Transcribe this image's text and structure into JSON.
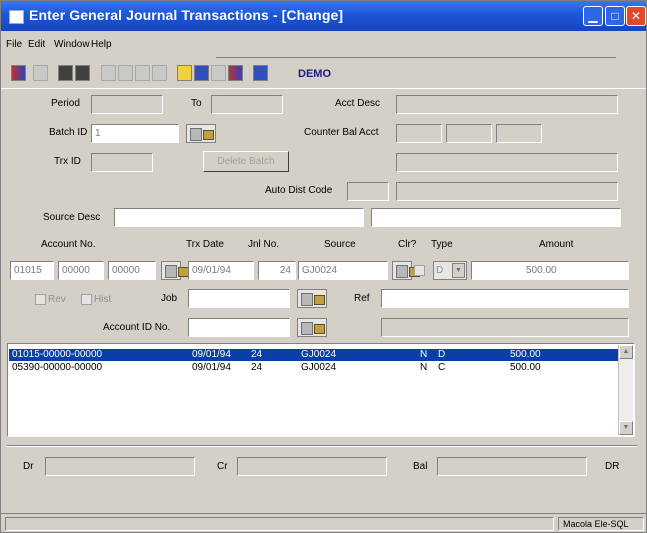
{
  "window": {
    "title": "Enter General Journal Transactions - [Change]"
  },
  "menu": [
    "File",
    "Edit",
    "Window",
    "Help"
  ],
  "toolbar": {
    "company": "DEMO"
  },
  "header": {
    "period_label": "Period",
    "period_value": "",
    "to_label": "To",
    "to_value": "",
    "acct_desc_label": "Acct Desc",
    "acct_desc_value": "",
    "batch_id_label": "Batch ID",
    "batch_id_value": "1",
    "counter_bal_label": "Counter Bal Acct",
    "trx_id_label": "Trx ID",
    "trx_id_value": "",
    "delete_batch_label": "Delete Batch",
    "auto_dist_label": "Auto Dist Code",
    "auto_dist_value": "",
    "source_desc_label": "Source Desc",
    "source_desc_value": ""
  },
  "entry": {
    "col_account": "Account No.",
    "col_trx_date": "Trx Date",
    "col_jnl_no": "Jnl No.",
    "col_source": "Source",
    "col_clr": "Clr?",
    "col_type": "Type",
    "col_amount": "Amount",
    "acct_seg1": "01015",
    "acct_seg2": "00000",
    "acct_seg3": "00000",
    "trx_date": "09/01/94",
    "jnl_no": "24",
    "source": "GJ0024",
    "type": "D",
    "amount": "500.00",
    "job_label": "Job",
    "ref_label": "Ref",
    "account_id_label": "Account ID No.",
    "cb1_label": "Rev",
    "cb2_label": "Hist"
  },
  "transactions": [
    {
      "account": "01015-00000-00000",
      "date": "09/01/94",
      "jnl": "24",
      "source": "GJ0024",
      "clr": "N",
      "type": "D",
      "amount": "500.00"
    },
    {
      "account": "05390-00000-00000",
      "date": "09/01/94",
      "jnl": "24",
      "source": "GJ0024",
      "clr": "N",
      "type": "C",
      "amount": "500.00"
    }
  ],
  "totals": {
    "dr_label": "Dr",
    "dr_value": "",
    "cr_label": "Cr",
    "cr_value": "",
    "bal_label": "Bal",
    "bal_value": "",
    "dr_suffix": "DR"
  },
  "status": {
    "right": "Macola Ele-SQL"
  }
}
